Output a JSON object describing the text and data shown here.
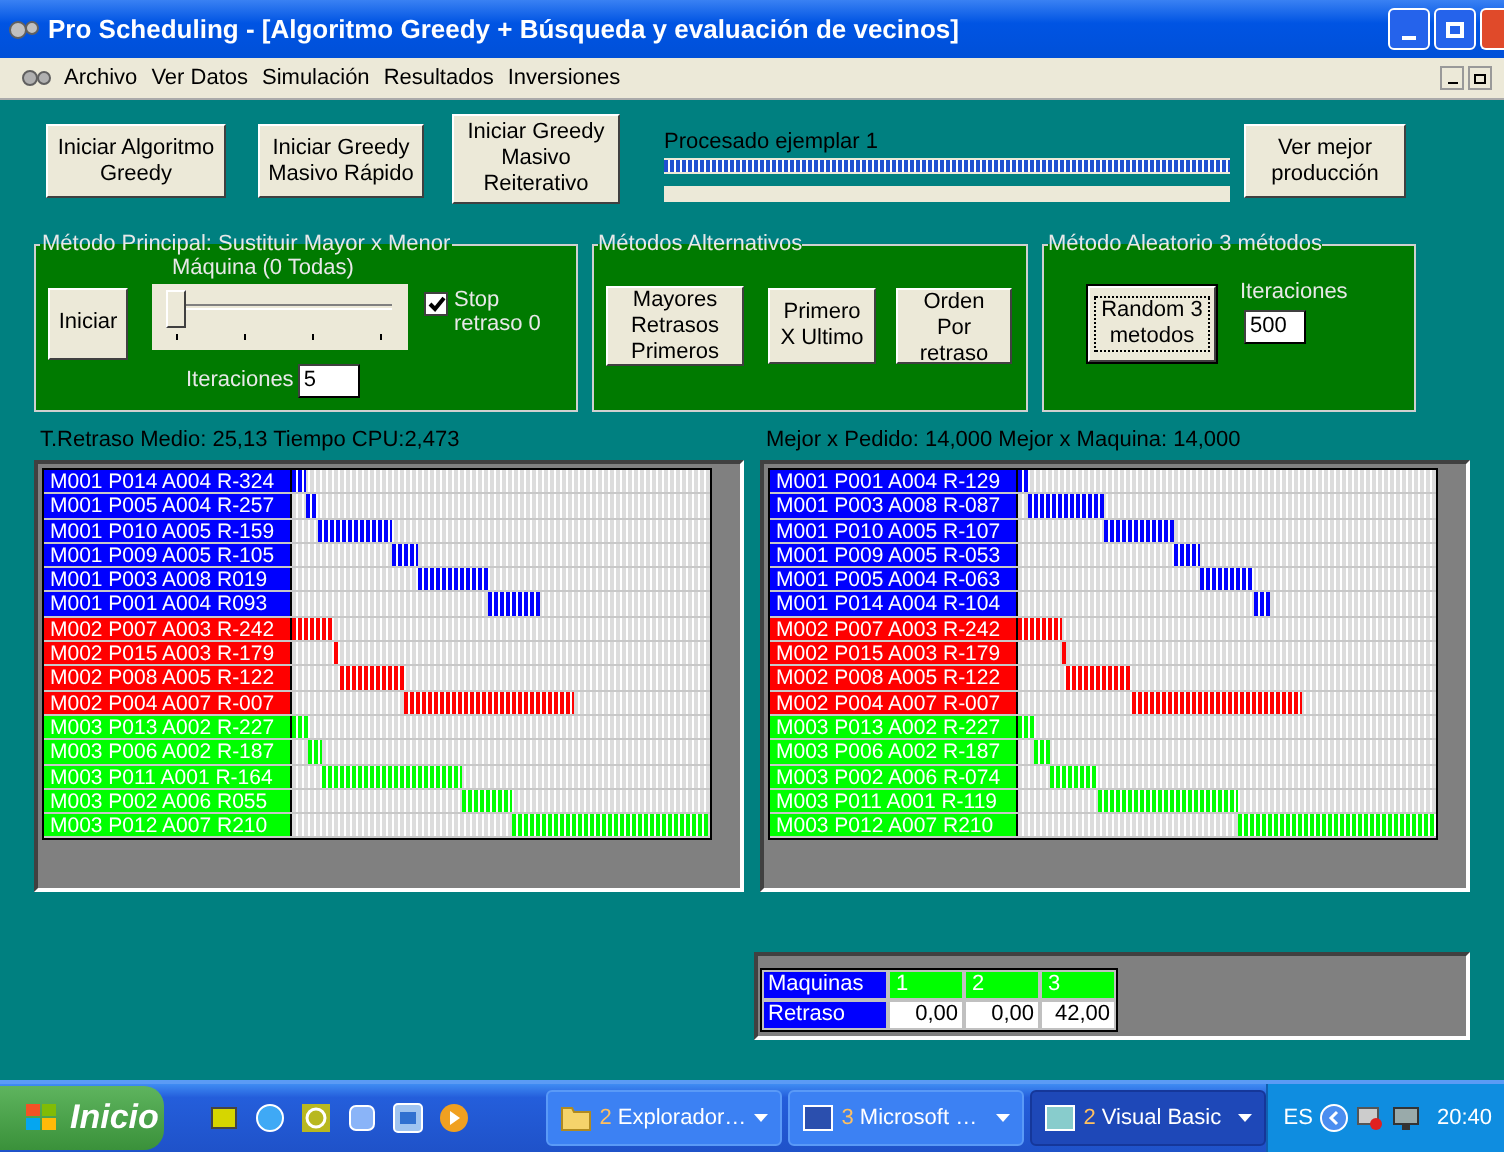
{
  "window": {
    "title": "Pro Scheduling - [Algoritmo Greedy + Búsqueda y evaluación de vecinos]"
  },
  "menu": {
    "items": [
      "Archivo",
      "Ver Datos",
      "Simulación",
      "Resultados",
      "Inversiones"
    ]
  },
  "top_buttons": [
    "Iniciar Algoritmo Greedy",
    "Iniciar Greedy Masivo Rápido",
    "Iniciar Greedy Masivo Reiterativo"
  ],
  "progress": {
    "label": "Procesado ejemplar  1",
    "level": 1
  },
  "best_button": "Ver mejor producción",
  "principal": {
    "title": "Método Principal: Sustituir Mayor x Menor",
    "start_button": "Iniciar",
    "slider_label": "Máquina (0 Todas)",
    "slider": {
      "level": 0
    },
    "stop": {
      "label": "Stop retraso 0",
      "checked": true
    },
    "iterations_label": "Iteraciones",
    "iterations": "5"
  },
  "alternatives": {
    "title": "Métodos Alternativos",
    "buttons": [
      "Mayores Retrasos Primeros",
      "Primero X Ultimo",
      "Orden Por retraso"
    ]
  },
  "random": {
    "title": "Método Aleatorio 3 métodos",
    "button": "Random 3 metodos",
    "iterations_label": "Iteraciones",
    "iterations": "500"
  },
  "schedules": [
    {
      "summary": "T.Retraso Medio: 25,13 Tiempo CPU:2,473",
      "rows": [
        {
          "label": "M001 P014 A004 R-324",
          "color": "#0000ff"
        },
        {
          "label": "M001 P005 A004 R-257",
          "color": "#0000ff"
        },
        {
          "label": "M001 P010 A005 R-159",
          "color": "#0000ff"
        },
        {
          "label": "M001 P009 A005 R-105",
          "color": "#0000ff"
        },
        {
          "label": "M001 P003 A008 R019",
          "color": "#0000ff"
        },
        {
          "label": "M001 P001 A004 R093",
          "color": "#0000ff"
        },
        {
          "label": "M002 P007 A003 R-242",
          "color": "#ff0000"
        },
        {
          "label": "M002 P015 A003 R-179",
          "color": "#ff0000"
        },
        {
          "label": "M002 P008 A005 R-122",
          "color": "#ff0000"
        },
        {
          "label": "M002 P004 A007 R-007",
          "color": "#ff0000"
        },
        {
          "label": "M003 P013 A002 R-227",
          "color": "#00ff00"
        },
        {
          "label": "M003 P006 A002 R-187",
          "color": "#00ff00"
        },
        {
          "label": "M003 P011 A001 R-164",
          "color": "#00ff00"
        },
        {
          "label": "M003 P002 A006 R055",
          "color": "#00ff00"
        },
        {
          "label": "M003 P012 A007 R210",
          "color": "#00ff00"
        }
      ]
    },
    {
      "summary": "Mejor x Pedido: 14,000 Mejor x Maquina: 14,000",
      "rows": [
        {
          "label": "M001 P001 A004 R-129",
          "color": "#0000ff"
        },
        {
          "label": "M001 P003 A008 R-087",
          "color": "#0000ff"
        },
        {
          "label": "M001 P010 A005 R-107",
          "color": "#0000ff"
        },
        {
          "label": "M001 P009 A005 R-053",
          "color": "#0000ff"
        },
        {
          "label": "M001 P005 A004 R-063",
          "color": "#0000ff"
        },
        {
          "label": "M001 P014 A004 R-104",
          "color": "#0000ff"
        },
        {
          "label": "M002 P007 A003 R-242",
          "color": "#ff0000"
        },
        {
          "label": "M002 P015 A003 R-179",
          "color": "#ff0000"
        },
        {
          "label": "M002 P008 A005 R-122",
          "color": "#ff0000"
        },
        {
          "label": "M002 P004 A007 R-007",
          "color": "#ff0000"
        },
        {
          "label": "M003 P013 A002 R-227",
          "color": "#00ff00"
        },
        {
          "label": "M003 P006 A002 R-187",
          "color": "#00ff00"
        },
        {
          "label": "M003 P002 A006 R-074",
          "color": "#00ff00"
        },
        {
          "label": "M003 P011 A001 R-119",
          "color": "#00ff00"
        },
        {
          "label": "M003 P012 A007 R210",
          "color": "#00ff00"
        }
      ]
    }
  ],
  "machine_table": {
    "header_label": "Maquinas",
    "columns": [
      "1",
      "2",
      "3"
    ],
    "row_label": "Retraso",
    "values": [
      "0,00",
      "0,00",
      "42,00"
    ]
  },
  "taskbar": {
    "start": "Inicio",
    "tasks": [
      {
        "count": "2",
        "label": "Explorador…",
        "selected": false
      },
      {
        "count": "3",
        "label": "Microsoft …",
        "selected": false
      },
      {
        "count": "2",
        "label": "Visual Basic",
        "selected": true
      }
    ],
    "language": "ES",
    "clock": "20:40"
  }
}
